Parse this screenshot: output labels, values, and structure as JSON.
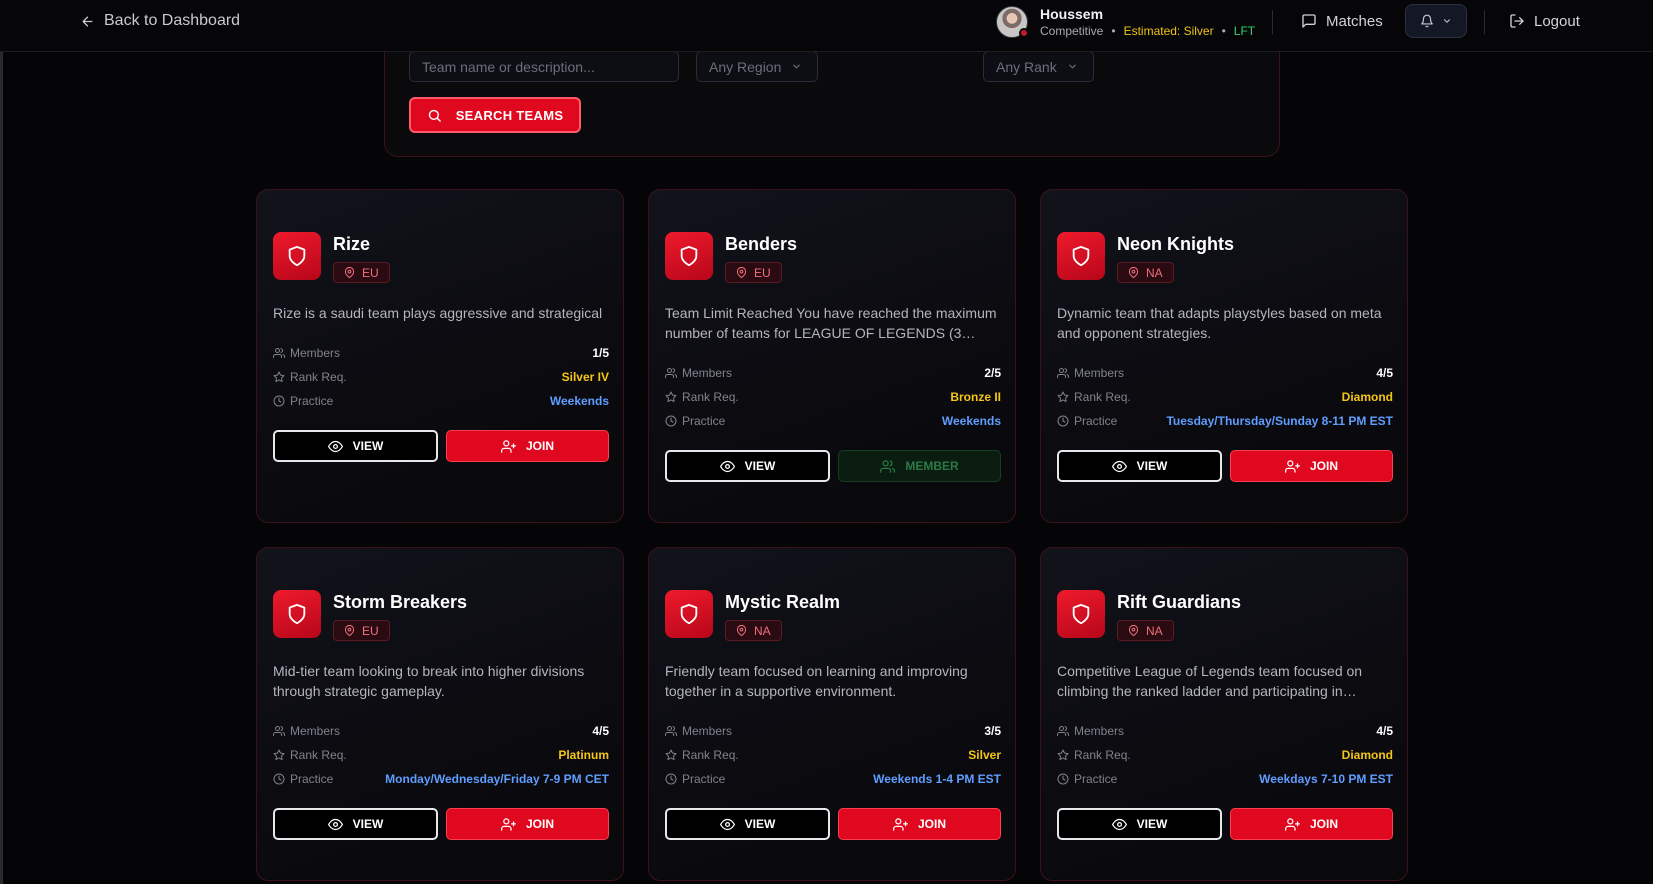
{
  "nav": {
    "back_label": "Back to Dashboard",
    "user_name": "Houssem",
    "user_mode": "Competitive",
    "user_estimated": "Estimated: Silver",
    "user_status": "LFT",
    "separator": "•",
    "matches_label": "Matches",
    "logout_label": "Logout"
  },
  "search": {
    "name_placeholder": "Team name or description...",
    "region_value": "Any Region",
    "rank_value": "Any Rank",
    "button_label": "SEARCH TEAMS"
  },
  "stat_labels": {
    "members": "Members",
    "rank": "Rank Req.",
    "practice": "Practice"
  },
  "buttons": {
    "view": "VIEW",
    "join": "JOIN",
    "member": "MEMBER"
  },
  "teams": [
    {
      "name": "Rize",
      "region": "EU",
      "description": "Rize is a saudi team plays aggressive and strategical",
      "members": "1/5",
      "rank": "Silver IV",
      "practice": "Weekends",
      "action": "join"
    },
    {
      "name": "Benders",
      "region": "EU",
      "description": "Team Limit Reached You have reached the maximum number of teams for LEAGUE OF LEGENDS (3…",
      "members": "2/5",
      "rank": "Bronze II",
      "practice": "Weekends",
      "action": "member"
    },
    {
      "name": "Neon Knights",
      "region": "NA",
      "description": "Dynamic team that adapts playstyles based on meta and opponent strategies.",
      "members": "4/5",
      "rank": "Diamond",
      "practice": "Tuesday/Thursday/Sunday 8-11 PM EST",
      "action": "join"
    },
    {
      "name": "Storm Breakers",
      "region": "EU",
      "description": "Mid-tier team looking to break into higher divisions through strategic gameplay.",
      "members": "4/5",
      "rank": "Platinum",
      "practice": "Monday/Wednesday/Friday 7-9 PM CET",
      "action": "join"
    },
    {
      "name": "Mystic Realm",
      "region": "NA",
      "description": "Friendly team focused on learning and improving together in a supportive environment.",
      "members": "3/5",
      "rank": "Silver",
      "practice": "Weekends 1-4 PM EST",
      "action": "join"
    },
    {
      "name": "Rift Guardians",
      "region": "NA",
      "description": "Competitive League of Legends team focused on climbing the ranked ladder and participating in…",
      "members": "4/5",
      "rank": "Diamond",
      "practice": "Weekdays 7-10 PM EST",
      "action": "join"
    }
  ]
}
